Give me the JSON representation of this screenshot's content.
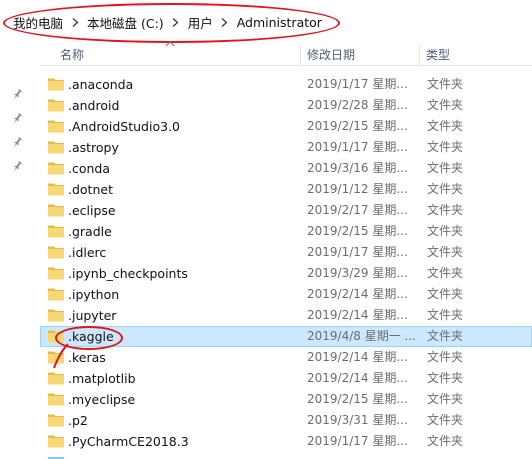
{
  "breadcrumb": {
    "items": [
      "我的电脑",
      "本地磁盘 (C:)",
      "用户",
      "Administrator"
    ]
  },
  "columns": {
    "name": "名称",
    "modified": "修改日期",
    "type": "类型"
  },
  "files": [
    {
      "name": ".anaconda",
      "modified": "2019/1/17 星期...",
      "type": "文件夹"
    },
    {
      "name": ".android",
      "modified": "2019/2/28 星期...",
      "type": "文件夹"
    },
    {
      "name": ".AndroidStudio3.0",
      "modified": "2019/2/15 星期...",
      "type": "文件夹"
    },
    {
      "name": ".astropy",
      "modified": "2019/1/17 星期...",
      "type": "文件夹"
    },
    {
      "name": ".conda",
      "modified": "2019/3/16 星期...",
      "type": "文件夹"
    },
    {
      "name": ".dotnet",
      "modified": "2019/1/12 星期...",
      "type": "文件夹"
    },
    {
      "name": ".eclipse",
      "modified": "2019/2/17 星期...",
      "type": "文件夹"
    },
    {
      "name": ".gradle",
      "modified": "2019/2/15 星期...",
      "type": "文件夹"
    },
    {
      "name": ".idlerc",
      "modified": "2019/1/17 星期...",
      "type": "文件夹"
    },
    {
      "name": ".ipynb_checkpoints",
      "modified": "2019/3/29 星期...",
      "type": "文件夹"
    },
    {
      "name": ".ipython",
      "modified": "2019/2/14 星期...",
      "type": "文件夹"
    },
    {
      "name": ".jupyter",
      "modified": "2019/2/14 星期...",
      "type": "文件夹"
    },
    {
      "name": ".kaggle",
      "modified": "2019/4/8 星期一 ...",
      "type": "文件夹",
      "selected": true
    },
    {
      "name": ".keras",
      "modified": "2019/2/14 星期...",
      "type": "文件夹"
    },
    {
      "name": ".matplotlib",
      "modified": "2019/2/14 星期...",
      "type": "文件夹"
    },
    {
      "name": ".myeclipse",
      "modified": "2019/2/15 星期...",
      "type": "文件夹"
    },
    {
      "name": ".p2",
      "modified": "2019/3/31 星期...",
      "type": "文件夹"
    },
    {
      "name": ".PyCharmCE2018.3",
      "modified": "2019/1/17 星期...",
      "type": "文件夹"
    }
  ],
  "colors": {
    "selection_bg": "#cce8ff",
    "selection_border": "#99d1ff",
    "folder": "#f8d775",
    "annotation": "#e3141b",
    "header_text": "#4c607a"
  },
  "icons": {
    "folder": "folder-icon",
    "pin": "pin-icon",
    "separator": "chevron-right-icon",
    "sort": "chevron-up-icon"
  }
}
